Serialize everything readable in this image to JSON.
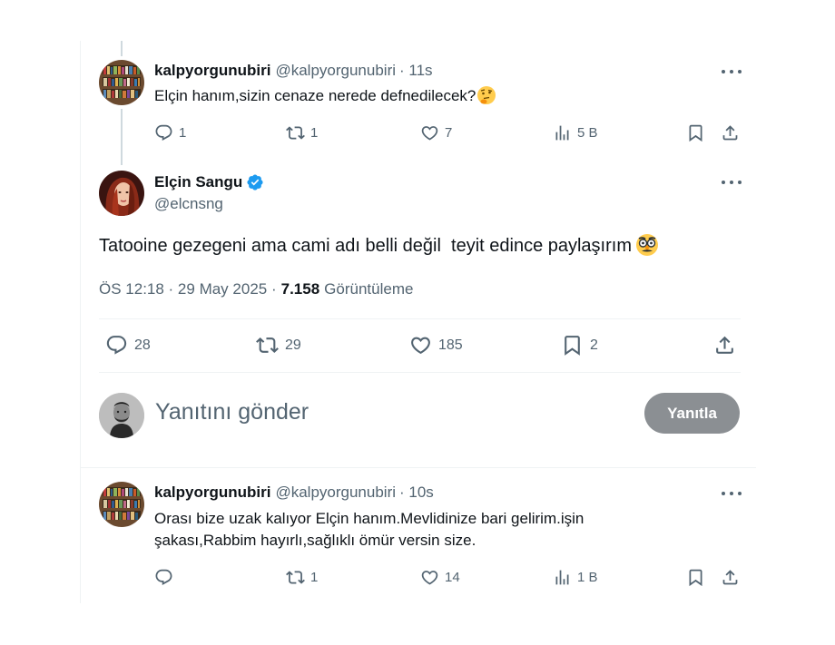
{
  "tweet1": {
    "display_name": "kalpyorgunubiri",
    "handle": "@kalpyorgunubiri",
    "time": "· 11s",
    "text": "Elçin hanım,sizin cenaze nerede defnedilecek?",
    "emoji": "thinking-face",
    "replies": "1",
    "retweets": "1",
    "likes": "7",
    "views": "5 B"
  },
  "main_tweet": {
    "display_name": "Elçin Sangu",
    "handle": "@elcnsng",
    "verified": true,
    "text": "Tatooine gezegeni ama cami adı belli değil  teyit edince paylaşırım",
    "emoji": "disguised-face",
    "timestamp": "ÖS 12:18 · 29 May 2025 ·",
    "views_count": "7.158",
    "views_label": "Görüntüleme",
    "replies": "28",
    "retweets": "29",
    "likes": "185",
    "bookmarks": "2"
  },
  "compose": {
    "placeholder": "Yanıtını gönder",
    "button_label": "Yanıtla"
  },
  "tweet2": {
    "display_name": "kalpyorgunubiri",
    "handle": "@kalpyorgunubiri",
    "time": "· 10s",
    "text_line1": "Orası bize uzak kalıyor Elçin hanım.Mevlidinize bari gelirim.işin",
    "text_line2": "şakası,Rabbim hayırlı,sağlıklı ömür versin size.",
    "replies": "",
    "retweets": "1",
    "likes": "14",
    "views": "1 B"
  },
  "colors": {
    "text_primary": "#0f1419",
    "text_secondary": "#536471",
    "verified": "#1d9bf0",
    "reply_button": "#8b8f93",
    "divider": "#eff3f4"
  }
}
